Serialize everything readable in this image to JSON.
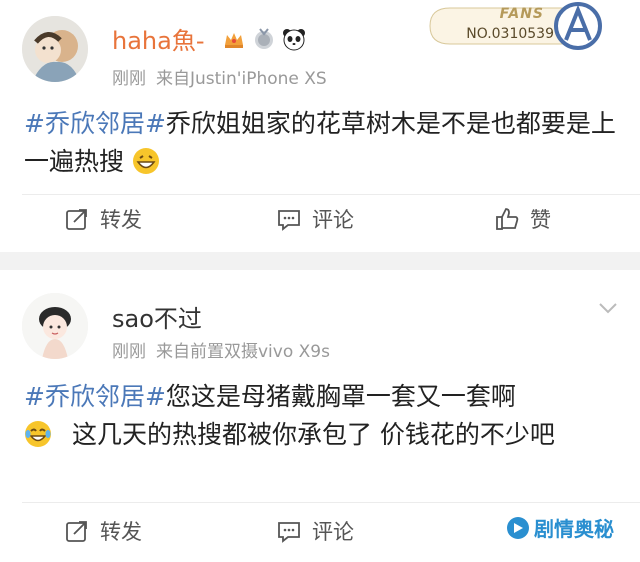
{
  "post1": {
    "username": "haha魚-",
    "time": "刚刚",
    "source": "来自Justin'iPhone XS",
    "hashtag": "#乔欣邻居#",
    "text": "乔欣姐姐家的花草树木是不是也都要是上一遍热搜",
    "fans_label": "FANS",
    "fans_number": "NO.0310539",
    "actions": {
      "repost": "转发",
      "comment": "评论",
      "like": "赞"
    }
  },
  "post2": {
    "username": "sao不过",
    "time": "刚刚",
    "source": "来自前置双摄vivo X9s",
    "hashtag": "#乔欣邻居#",
    "text1": "您这是母猪戴胸罩一套又一套啊",
    "text2": "这几天的热搜都被你承包了  价钱花的不少吧",
    "actions": {
      "repost": "转发",
      "comment": "评论"
    }
  },
  "watermark": "剧情奥秘",
  "colors": {
    "hashtag": "#4b78b8",
    "username_vip": "#e8743b",
    "meta": "#999999",
    "watermark": "#2a8fd0"
  }
}
